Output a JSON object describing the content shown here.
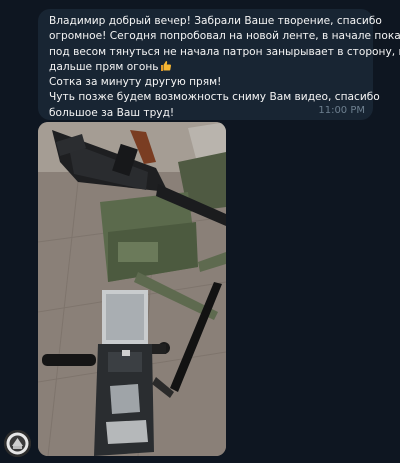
{
  "message": {
    "lines": [
      "Владимир добрый вечер! Забрали Ваше творение, спасибо",
      "огромное! Сегодня попробовал на новой ленте, в начале пока",
      "под весом тянуться не начала патрон занырывает в сторону, но",
      "дальше прям огонь",
      "Сотка за минуту другую прям!",
      "Чуть позже будем возможность сниму Вам видео, спасибо",
      "большое за Ваш труд!"
    ],
    "reaction_icon": "thumbs-up-emoji",
    "time": "11:00 PM"
  },
  "photo": {
    "icon": "photo-attachment"
  },
  "sender": {
    "avatar_icon": "avatar-round"
  }
}
